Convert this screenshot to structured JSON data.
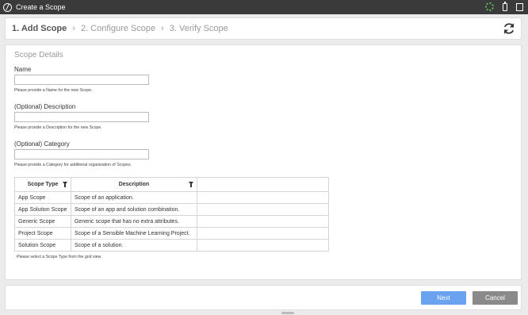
{
  "window": {
    "title": "Create a Scope"
  },
  "steps": [
    {
      "label": "1. Add Scope"
    },
    {
      "label": "2. Configure Scope"
    },
    {
      "label": "3. Verify Scope"
    }
  ],
  "form": {
    "section_title": "Scope Details",
    "name": {
      "label": "Name",
      "value": "",
      "hint": "Please provide a Name for the new Scope."
    },
    "description": {
      "label": "(Optional) Description",
      "value": "",
      "hint": "Please provide a Description for the new Scope."
    },
    "category": {
      "label": "(Optional) Category",
      "value": "",
      "hint": "Please provide a Category for additional organization of Scopes."
    }
  },
  "grid": {
    "columns": [
      "Scope Type",
      "Description"
    ],
    "rows": [
      [
        "App Scope",
        "Scope of an application."
      ],
      [
        "App Solution Scope",
        "Scope of an app and solution combination."
      ],
      [
        "Generic Scope",
        "Generic scope that has no extra attributes."
      ],
      [
        "Project Scope",
        "Scope of a Sensible Machine Learning Project."
      ],
      [
        "Solution Scope",
        "Scope of a solution."
      ]
    ],
    "hint": "Please select a Scope Type from the grid view."
  },
  "footer": {
    "next_label": "Next",
    "cancel_label": "Cancel"
  },
  "colors": {
    "next": "#6aa2f0",
    "cancel": "#8a8a8a",
    "titlebar": "#3a3a3a"
  },
  "icons": [
    "app-logo-icon",
    "spinner-icon",
    "battery-icon",
    "window-icon",
    "chevron-right-icon",
    "refresh-icon",
    "filter-icon"
  ]
}
